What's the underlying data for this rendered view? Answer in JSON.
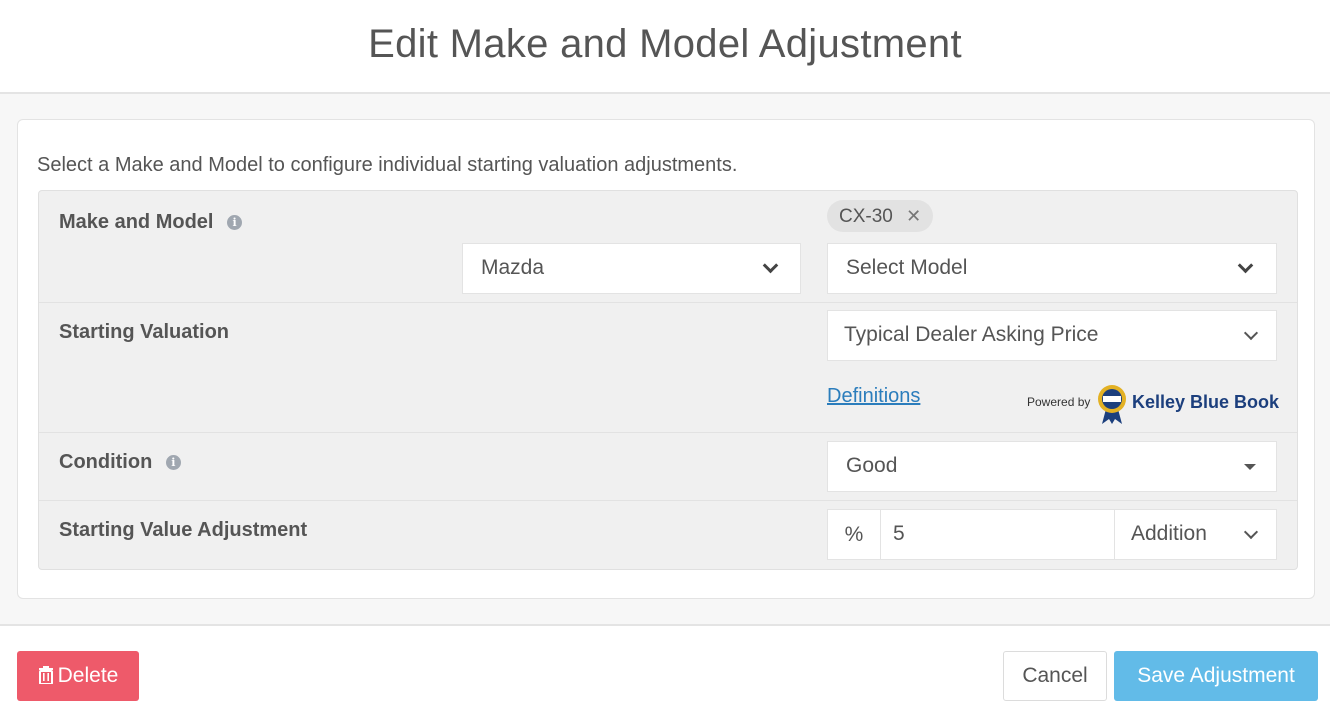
{
  "modal": {
    "title": "Edit Make and Model Adjustment",
    "intro": "Select a Make and Model to configure individual starting valuation adjustments."
  },
  "make_model": {
    "label": "Make and Model",
    "make_value": "Mazda",
    "model_placeholder": "Select Model",
    "selected_tags": [
      "CX-30"
    ]
  },
  "starting_valuation": {
    "label": "Starting Valuation",
    "value": "Typical Dealer Asking Price",
    "definitions_link": "Definitions",
    "powered_by": "Powered by",
    "brand": "Kelley Blue Book"
  },
  "condition": {
    "label": "Condition",
    "value": "Good"
  },
  "starting_value_adjustment": {
    "label": "Starting Value Adjustment",
    "unit": "%",
    "amount": "5",
    "operation": "Addition"
  },
  "footer": {
    "delete_label": "Delete",
    "cancel_label": "Cancel",
    "save_label": "Save Adjustment"
  },
  "colors": {
    "delete": "#ee5a6a",
    "save": "#62bbe8",
    "link": "#2b7dbc",
    "kbb_brand": "#1c3f7d"
  }
}
